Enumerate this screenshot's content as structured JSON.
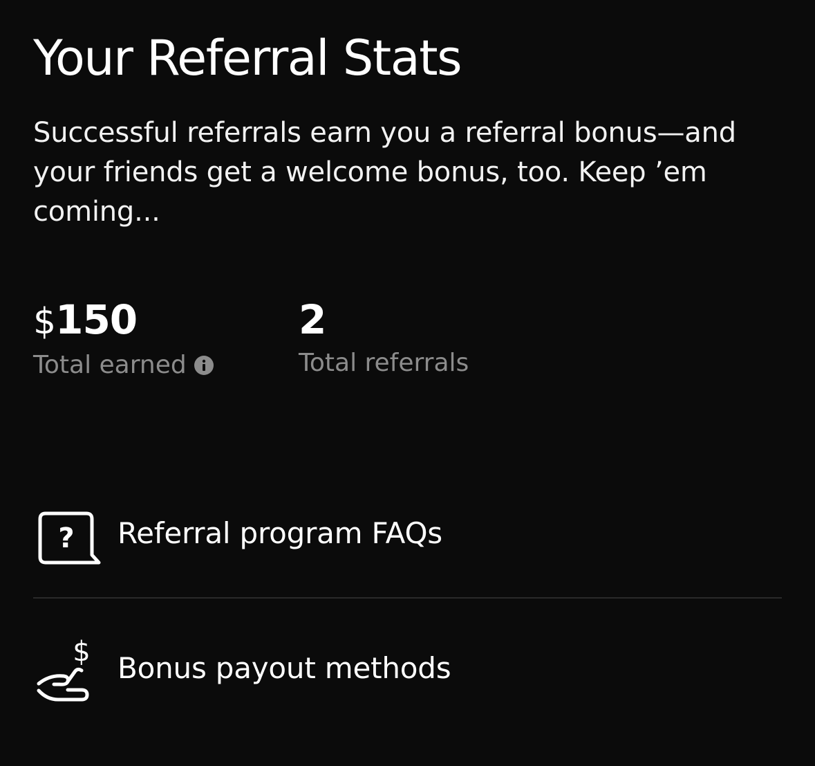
{
  "header": {
    "title": "Your Referral Stats",
    "description": "Successful referrals earn you a referral bonus—and your friends get a welcome bonus, too. Keep ’em coming..."
  },
  "stats": {
    "earned": {
      "currency_symbol": "$",
      "value": "150",
      "label": "Total earned",
      "info_icon": "info-icon"
    },
    "referrals": {
      "value": "2",
      "label": "Total referrals"
    }
  },
  "menu": {
    "items": [
      {
        "icon": "question-bubble-icon",
        "label": "Referral program FAQs"
      },
      {
        "icon": "hand-dollar-icon",
        "label": "Bonus payout methods"
      }
    ]
  },
  "colors": {
    "background": "#0b0b0b",
    "text_primary": "#ffffff",
    "text_secondary": "#8c8c8c",
    "divider": "#2a2a2a"
  }
}
